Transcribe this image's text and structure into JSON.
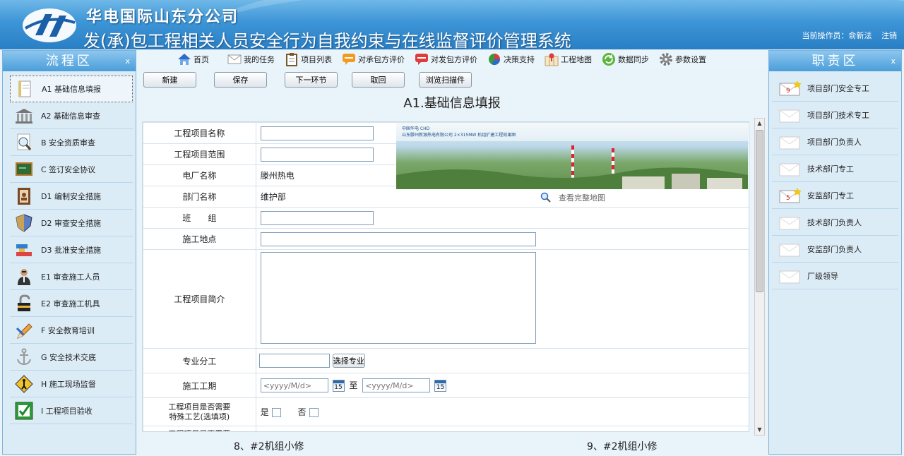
{
  "header": {
    "company": "华电国际山东分公司",
    "system": "发(承)包工程相关人员安全行为自我约束与在线监督评价管理系统",
    "operator_label": "当前操作员：",
    "operator": "俞新法",
    "logout": "注销"
  },
  "left_panel": {
    "title": "流程区",
    "close": "x",
    "items": [
      {
        "label": "A1 基础信息填报",
        "icon": "notepad-icon"
      },
      {
        "label": "A2 基础信息审查",
        "icon": "building-icon"
      },
      {
        "label": "B  安全资质审查",
        "icon": "magnifier-icon"
      },
      {
        "label": "C 签订安全协议",
        "icon": "chalkboard-icon"
      },
      {
        "label": "D1 编制安全措施",
        "icon": "contact-book-icon"
      },
      {
        "label": "D2 审查安全措施",
        "icon": "shield-icon"
      },
      {
        "label": "D3 批准安全措施",
        "icon": "stamp-icon"
      },
      {
        "label": "E1 审查施工人员",
        "icon": "person-icon"
      },
      {
        "label": "E2 审查施工机具",
        "icon": "padlock-icon"
      },
      {
        "label": "F 安全教育培训",
        "icon": "pencil-icon"
      },
      {
        "label": "G  安全技术交底",
        "icon": "anchor-icon"
      },
      {
        "label": "H  施工现场监督",
        "icon": "warning-sign-icon"
      },
      {
        "label": "I  工程项目验收",
        "icon": "checkbox-icon"
      }
    ]
  },
  "right_panel": {
    "title": "职责区",
    "close": "x",
    "items": [
      {
        "label": "项目部门安全专工",
        "badge": "9"
      },
      {
        "label": "项目部门技术专工",
        "badge": ""
      },
      {
        "label": "项目部门负责人",
        "badge": ""
      },
      {
        "label": "技术部门专工",
        "badge": ""
      },
      {
        "label": "安监部门专工",
        "badge": "5"
      },
      {
        "label": "技术部门负责人",
        "badge": ""
      },
      {
        "label": "安监部门负责人",
        "badge": ""
      },
      {
        "label": "厂级领导",
        "badge": ""
      }
    ]
  },
  "toolbar": [
    {
      "label": "首页",
      "icon": "home-icon"
    },
    {
      "label": "我的任务",
      "icon": "mail-icon"
    },
    {
      "label": "项目列表",
      "icon": "clipboard-icon"
    },
    {
      "label": "对承包方评价",
      "icon": "chat-orange-icon"
    },
    {
      "label": "对发包方评价",
      "icon": "chat-red-icon"
    },
    {
      "label": "决策支持",
      "icon": "pie-chart-icon"
    },
    {
      "label": "工程地图",
      "icon": "map-icon"
    },
    {
      "label": "数据同步",
      "icon": "sync-icon"
    },
    {
      "label": "参数设置",
      "icon": "gear-icon"
    }
  ],
  "actions": [
    "新建",
    "保存",
    "下一环节",
    "取回",
    "浏览扫描件"
  ],
  "form": {
    "title": "A1.基础信息填报",
    "project_name_label": "工程项目名称",
    "project_scope_label": "工程项目范围",
    "plant_label": "电厂名称",
    "plant_value": "滕州热电",
    "dept_label": "部门名称",
    "dept_value": "维护部",
    "team_label": "班　　组",
    "location_label": "施工地点",
    "intro_label": "工程项目简介",
    "specialty_label": "专业分工",
    "specialty_button": "选择专业",
    "period_label": "施工工期",
    "date_placeholder": "<yyyy/M/d>",
    "date_sep": "至",
    "cal_day": "15",
    "special_process_label_1": "工程项目是否需要",
    "special_process_label_2": "特殊工艺(选填项)",
    "yes": "是",
    "no": "否",
    "next_row_label": "工程项目是否需要",
    "map_link": "查看完整地图",
    "photo_caption_1": "中国华电 CHD",
    "photo_caption_2": "山东滕州新源热电有限公司 2×315MW 机组扩建工程效果图"
  },
  "footer": {
    "left": "8、#2机组小修",
    "right": "9、#2机组小修"
  }
}
